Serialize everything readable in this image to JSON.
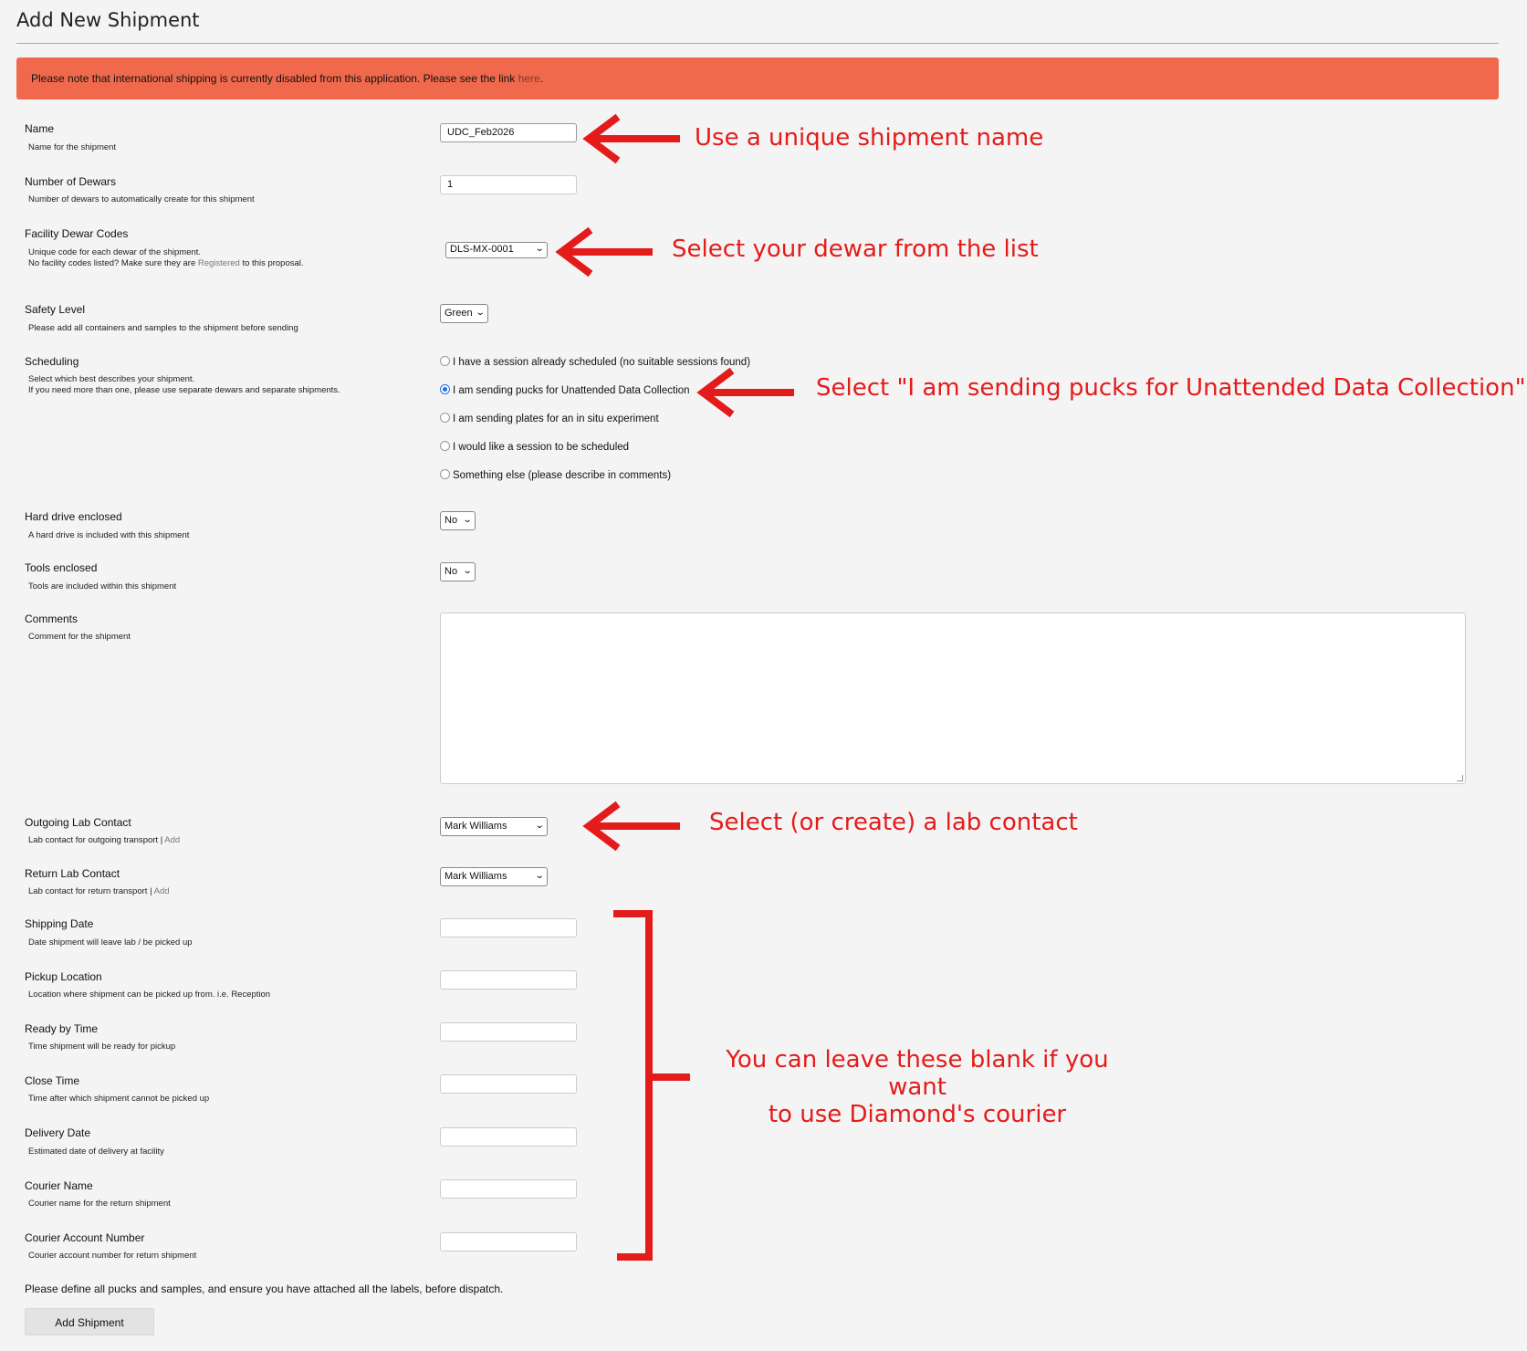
{
  "page": {
    "title": "Add New Shipment"
  },
  "banner": {
    "text": "Please note that international shipping is currently disabled from this application. Please see the link ",
    "link": "here",
    "end": "."
  },
  "fields": {
    "name": {
      "label": "Name",
      "desc": "Name for the shipment",
      "value": "UDC_Feb2026"
    },
    "dewars": {
      "label": "Number of Dewars",
      "desc": "Number of dewars to automatically create for this shipment",
      "value": "1"
    },
    "facility_codes": {
      "label": "Facility Dewar Codes",
      "desc1": "Unique code for each dewar of the shipment.",
      "desc2_a": "No facility codes listed? Make sure they are ",
      "desc2_link": "Registered",
      "desc2_b": " to this proposal.",
      "value": "DLS-MX-0001"
    },
    "safety": {
      "label": "Safety Level",
      "desc": "Please add all containers and samples to the shipment before sending",
      "value": "Green"
    },
    "scheduling": {
      "label": "Scheduling",
      "desc1": "Select which best describes your shipment.",
      "desc2": "If you need more than one, please use separate dewars and separate shipments.",
      "options": [
        "I have a session already scheduled (no suitable sessions found)",
        "I am sending pucks for Unattended Data Collection",
        "I am sending plates for an in situ experiment",
        "I would like a session to be scheduled",
        "Something else (please describe in comments)"
      ],
      "selected_index": 1
    },
    "hard_drive": {
      "label": "Hard drive enclosed",
      "desc": "A hard drive is included with this shipment",
      "value": "No"
    },
    "tools": {
      "label": "Tools enclosed",
      "desc": "Tools are included within this shipment",
      "value": "No"
    },
    "comments": {
      "label": "Comments",
      "desc": "Comment for the shipment",
      "value": ""
    },
    "outgoing_contact": {
      "label": "Outgoing Lab Contact",
      "desc": "Lab contact for outgoing transport | ",
      "add": "Add",
      "value": "Mark Williams"
    },
    "return_contact": {
      "label": "Return Lab Contact",
      "desc": "Lab contact for return transport | ",
      "add": "Add",
      "value": "Mark Williams"
    },
    "shipping_date": {
      "label": "Shipping Date",
      "desc": "Date shipment will leave lab / be picked up",
      "value": ""
    },
    "pickup_location": {
      "label": "Pickup Location",
      "desc": "Location where shipment can be picked up from. i.e. Reception",
      "value": ""
    },
    "ready_time": {
      "label": "Ready by Time",
      "desc": "Time shipment will be ready for pickup",
      "value": ""
    },
    "close_time": {
      "label": "Close Time",
      "desc": "Time after which shipment cannot be picked up",
      "value": ""
    },
    "delivery_date": {
      "label": "Delivery Date",
      "desc": "Estimated date of delivery at facility",
      "value": ""
    },
    "courier_name": {
      "label": "Courier Name",
      "desc": "Courier name for the return shipment",
      "value": ""
    },
    "courier_account": {
      "label": "Courier Account Number",
      "desc": "Courier account number for return shipment",
      "value": ""
    }
  },
  "footer": {
    "note": "Please define all pucks and samples, and ensure you have attached all the labels, before dispatch.",
    "submit_label": "Add Shipment"
  },
  "annotations": {
    "name": "Use a unique shipment name",
    "dewar": "Select your dewar from the list",
    "scheduling": "Select \"I am sending pucks for Unattended Data Collection\"",
    "contact": "Select (or create) a lab contact",
    "blank_line1": "You can leave these blank if you want",
    "blank_line2": "to use Diamond's courier",
    "color": "#e41b1b"
  },
  "icons": {
    "select_chevron": "chevron-down-icon",
    "arrow": "left-arrow-icon",
    "bracket": "right-bracket-icon"
  }
}
